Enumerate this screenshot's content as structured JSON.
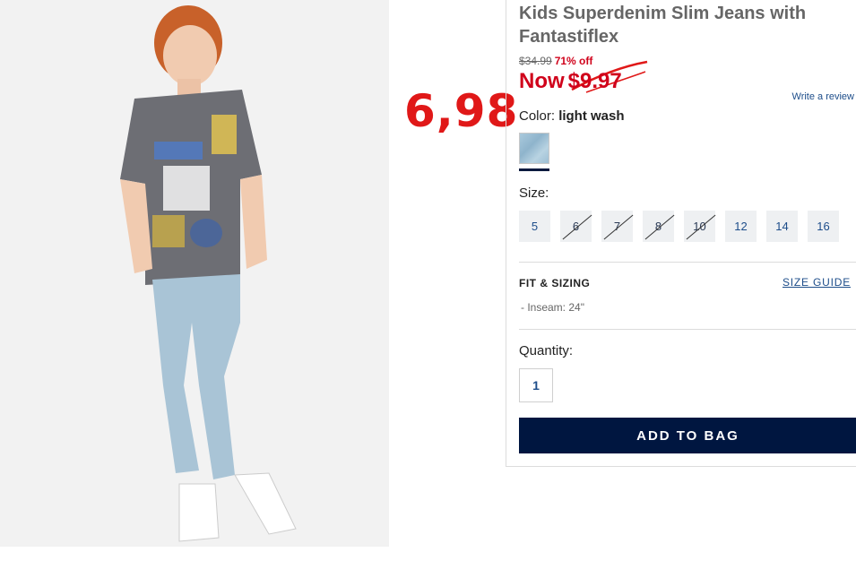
{
  "annotation": {
    "handwritten_price": "6,98"
  },
  "product": {
    "title": "Kids Superdenim Slim Jeans with Fantastiflex",
    "original_price": "$34.99",
    "discount": "71% off",
    "now_label": "Now",
    "now_price": "$9.97",
    "write_review": "Write a review",
    "color_label": "Color:",
    "color_value": "light wash",
    "size_label": "Size:",
    "sizes": [
      {
        "label": "5",
        "available": true
      },
      {
        "label": "6",
        "available": false
      },
      {
        "label": "7",
        "available": false
      },
      {
        "label": "8",
        "available": false
      },
      {
        "label": "10",
        "available": false
      },
      {
        "label": "12",
        "available": true
      },
      {
        "label": "14",
        "available": true
      },
      {
        "label": "16",
        "available": true
      }
    ],
    "fit_title": "FIT & SIZING",
    "size_guide": "SIZE GUIDE",
    "inseam": "- Inseam: 24\"",
    "quantity_label": "Quantity:",
    "quantity_value": "1",
    "add_to_bag": "ADD TO BAG"
  },
  "colors": {
    "sale_red": "#d0021b",
    "link_blue": "#1d4d8a",
    "button_navy": "#001640",
    "annotation_red": "#e01818"
  }
}
